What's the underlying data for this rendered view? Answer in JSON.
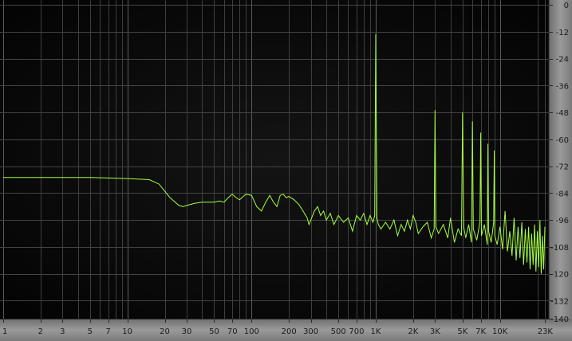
{
  "chart_data": {
    "type": "line",
    "title": "",
    "xlabel": "",
    "ylabel": "",
    "x_scale": "log",
    "xlim": [
      1,
      23000
    ],
    "ylim": [
      -140,
      0
    ],
    "grid": true,
    "colors": {
      "background": "#0b0b0b",
      "grid": "#4a4a4a",
      "trace": "#a6ff40",
      "axis_panel": "#8a8a8a",
      "axis_text": "#1a1a1a"
    },
    "y_ticks": [
      0,
      -12,
      -24,
      -36,
      -48,
      -60,
      -72,
      -84,
      -96,
      -108,
      -120,
      -132,
      -140
    ],
    "y_tick_labels": [
      "0",
      "-12",
      "-24",
      "-36",
      "-48",
      "-60",
      "-72",
      "-84",
      "-96",
      "-108",
      "-120",
      "-132",
      "-140"
    ],
    "x_ticks": [
      1,
      2,
      3,
      5,
      7,
      10,
      20,
      30,
      50,
      70,
      100,
      200,
      300,
      500,
      700,
      1000,
      2000,
      3000,
      5000,
      7000,
      10000,
      23000
    ],
    "x_tick_labels": [
      "1",
      "2",
      "3",
      "5",
      "7",
      "10",
      "20",
      "30",
      "50",
      "70",
      "100",
      "200",
      "300",
      "500",
      "700",
      "1K",
      "2K",
      "3K",
      "5K",
      "7K",
      "10K",
      "23K"
    ],
    "series": [
      {
        "x": [
          1,
          2,
          5,
          10,
          15,
          18,
          22,
          26,
          28,
          30,
          35,
          40,
          45,
          50,
          55,
          60,
          65,
          70,
          75,
          80,
          90,
          100,
          110,
          120,
          130,
          140,
          150,
          160,
          170,
          180,
          190,
          200,
          220,
          240,
          260,
          280,
          290,
          300,
          320,
          340,
          360,
          380,
          400,
          430,
          460,
          500,
          550,
          600,
          650,
          700,
          750,
          800,
          850,
          900,
          950,
          980,
          1000,
          1020,
          1050,
          1100,
          1200,
          1300,
          1400,
          1500,
          1600,
          1700,
          1800,
          1900,
          2000,
          2100,
          2200,
          2400,
          2600,
          2800,
          2950,
          3000,
          3050,
          3200,
          3500,
          3800,
          4000,
          4300,
          4600,
          4900,
          5000,
          5100,
          5300,
          5600,
          5900,
          6000,
          6100,
          6500,
          6900,
          7000,
          7100,
          7500,
          7900,
          8000,
          8100,
          8500,
          8900,
          9000,
          9100,
          9500,
          10000,
          10500,
          11000,
          11500,
          12000,
          12500,
          13000,
          13500,
          14000,
          14500,
          15000,
          15500,
          16000,
          16500,
          17000,
          17500,
          18000,
          18500,
          19000,
          19500,
          20000,
          20500,
          21000,
          21500,
          22000,
          22500,
          23000
        ],
        "y": [
          -77,
          -77,
          -77,
          -77.5,
          -78,
          -80,
          -86,
          -89.5,
          -90,
          -89.5,
          -88.5,
          -88,
          -88,
          -88,
          -87.5,
          -88,
          -86,
          -84.5,
          -86,
          -87,
          -84.5,
          -85,
          -90,
          -92,
          -88,
          -85,
          -88,
          -90,
          -85,
          -84.5,
          -86,
          -85.5,
          -87,
          -89,
          -92,
          -95,
          -98,
          -96,
          -92,
          -90,
          -94,
          -92,
          -96,
          -93,
          -98,
          -94,
          -97,
          -95,
          -101,
          -94,
          -96,
          -93,
          -98,
          -94,
          -97,
          -94,
          -13,
          -95,
          -98,
          -100,
          -97,
          -100,
          -96,
          -103,
          -98,
          -101,
          -96,
          -100,
          -94,
          -97,
          -102,
          -99,
          -97,
          -104,
          -100,
          -47,
          -99,
          -102,
          -98,
          -104,
          -95,
          -106,
          -100,
          -103,
          -48,
          -99,
          -104,
          -98,
          -106,
          -52,
          -100,
          -105,
          -97,
          -57,
          -103,
          -98,
          -107,
          -62,
          -101,
          -106,
          -97,
          -65,
          -103,
          -107,
          -99,
          -109,
          -92,
          -110,
          -101,
          -112,
          -95,
          -114,
          -99,
          -113,
          -97,
          -116,
          -100,
          -115,
          -99,
          -118,
          -102,
          -116,
          -98,
          -119,
          -101,
          -117,
          -96,
          -120,
          -103,
          -118,
          -99
        ]
      }
    ]
  }
}
